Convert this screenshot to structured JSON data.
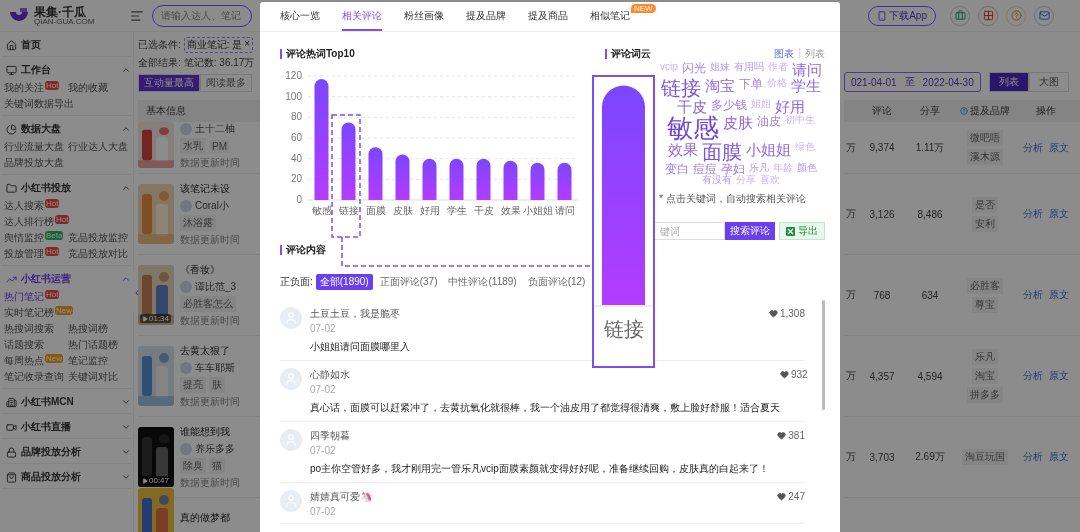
{
  "header": {
    "logo": "果集·千瓜",
    "logo_sub": "QIAN-GUA.COM",
    "search": {
      "placeholder": "请输入达人、笔记"
    },
    "download_button": "下载App"
  },
  "sidebar": {
    "collapse_handle": "«",
    "sections": [
      {
        "title": "首页",
        "kind": "link",
        "active": false
      },
      {
        "title": "工作台",
        "kind": "group",
        "active": false,
        "expanded": true,
        "items": [
          {
            "label": "我的关注",
            "selected": false,
            "badge": {
              "text": "Hot",
              "kind": "hot"
            }
          },
          {
            "label": "我的收藏",
            "selected": false
          },
          {
            "label": "关键词数据导出",
            "selected": false
          }
        ]
      },
      {
        "title": "数据大盘",
        "kind": "group",
        "active": false,
        "expanded": true,
        "items": [
          {
            "label": "行业流量大盘",
            "selected": false
          },
          {
            "label": "行业达人大盘",
            "selected": false
          },
          {
            "label": "品牌投放大盘",
            "selected": false
          }
        ]
      },
      {
        "title": "小红书投放",
        "kind": "group",
        "active": false,
        "expanded": true,
        "items": [
          {
            "label": "达人搜索",
            "selected": false,
            "badge": {
              "text": "Hot",
              "kind": "hot"
            }
          },
          {
            "label": "达人排行榜",
            "selected": false,
            "badge": {
              "text": "Hot",
              "kind": "hot"
            }
          },
          {
            "label": "舆情监控",
            "selected": false,
            "badge": {
              "text": "Beta",
              "kind": "beta"
            }
          },
          {
            "label": "竞品投放监控",
            "selected": false
          },
          {
            "label": "投放管理",
            "selected": false,
            "badge": {
              "text": "Hot",
              "kind": "hot"
            }
          },
          {
            "label": "竞品投放对比",
            "selected": false
          }
        ]
      },
      {
        "title": "小红书运营",
        "kind": "group",
        "active": true,
        "expanded": true,
        "items": [
          {
            "label": "热门笔记",
            "selected": true,
            "badge": {
              "text": "Hot",
              "kind": "hot"
            }
          },
          {
            "label": "实时笔记榜",
            "selected": false,
            "badge": {
              "text": "New",
              "kind": "new"
            }
          },
          {
            "label": "热搜词搜索",
            "selected": false
          },
          {
            "label": "热搜词榜",
            "selected": false
          },
          {
            "label": "话题搜索",
            "selected": false
          },
          {
            "label": "热门话题榜",
            "selected": false
          },
          {
            "label": "每周热点",
            "selected": false,
            "badge": {
              "text": "New",
              "kind": "new"
            }
          },
          {
            "label": "笔记监控",
            "selected": false
          },
          {
            "label": "笔记收录查询",
            "selected": false
          },
          {
            "label": "关键词对比",
            "selected": false
          }
        ]
      },
      {
        "title": "小红书MCN",
        "kind": "group",
        "active": false,
        "expanded": false
      },
      {
        "title": "小红书直播",
        "kind": "group",
        "active": false,
        "expanded": false
      },
      {
        "title": "品牌投放分析",
        "kind": "group",
        "active": false,
        "expanded": false
      },
      {
        "title": "商品投放分析",
        "kind": "group",
        "active": false,
        "expanded": false
      }
    ]
  },
  "notes": {
    "filter_label": "已选条件:",
    "filter_chip": "商业笔记: 是",
    "chip_close": "×",
    "result_label": "全部结果:",
    "result_count": "笔记数: 36.17万",
    "sort_tabs": [
      {
        "label": "互动量最高",
        "selected": true
      },
      {
        "label": "阅读最多",
        "selected": false
      }
    ],
    "date_from": "021-04-01",
    "date_sep": "至",
    "date_to": "2022-04-30",
    "view_toggle": [
      {
        "label": "列表",
        "selected": true
      },
      {
        "label": "大图",
        "selected": false
      }
    ],
    "columns": [
      "基本信息",
      "评论",
      "分享",
      "提及品牌",
      "操作"
    ],
    "rows": [
      {
        "author": "土十二柚",
        "tags": [
          "水乳",
          "PM"
        ],
        "update": "数据更新时间",
        "col_cut": "万",
        "comments": "9,374",
        "shares": "1.11万",
        "brands": [
          "微吧唔",
          "溪木源"
        ],
        "actions": [
          "分析",
          "原文"
        ]
      },
      {
        "title": "该笔记未设",
        "author": "Coral小",
        "tags": [
          "沐浴露"
        ],
        "update": "数据更新时间",
        "col_cut": "万",
        "comments": "3,126",
        "shares": "8,486",
        "brands": [
          "是否",
          "安利"
        ],
        "actions": [
          "分析",
          "原文"
        ]
      },
      {
        "title": "《香妆》",
        "author": "谭比范_3",
        "tags": [
          "必胜客怎么"
        ],
        "update": "数据更新时间",
        "duration": "01:34",
        "col_cut": "万",
        "comments": "768",
        "shares": "634",
        "brands": [
          "必胜客",
          "尊宝"
        ],
        "actions": [
          "分析",
          "原文"
        ]
      },
      {
        "title": "去黄太狠了",
        "author": "车车耶斯",
        "tags": [
          "提亮",
          "肤"
        ],
        "update": "数据更新时间",
        "col_cut": "万",
        "comments": "4,357",
        "shares": "4,594",
        "brands": [
          "乐凡",
          "淘宝",
          "拼多多"
        ],
        "actions": [
          "分析",
          "原文"
        ]
      },
      {
        "title": "谁能想到我",
        "author": "养乐多多",
        "tags": [
          "除臭",
          "猫"
        ],
        "update": "数据更新时间",
        "duration": "00:47",
        "col_cut": "万",
        "comments": "3,703",
        "shares": "2.69万",
        "brands": [
          "淘豆玩国"
        ],
        "actions": [
          "分析",
          "原文"
        ]
      },
      {
        "title": "真的做梦都"
      }
    ]
  },
  "modal": {
    "tabs": [
      {
        "label": "核心一览",
        "selected": false
      },
      {
        "label": "相关评论",
        "selected": true
      },
      {
        "label": "粉丝画像",
        "selected": false
      },
      {
        "label": "提及品牌",
        "selected": false
      },
      {
        "label": "提及商品",
        "selected": false
      },
      {
        "label": "相似笔记",
        "selected": false,
        "badge": "NEW"
      }
    ],
    "hot_words": {
      "chart_data": {
        "type": "bar",
        "title": "评论热词Top10",
        "categories": [
          "敏感",
          "链接",
          "面膜",
          "皮肤",
          "好用",
          "学生",
          "干皮",
          "效果",
          "小姐姐",
          "请问"
        ],
        "values": [
          117,
          75,
          51,
          44,
          40,
          40,
          40,
          38,
          36,
          36
        ],
        "ylim": [
          0,
          120
        ],
        "yticks": [
          0,
          20,
          40,
          60,
          80,
          100,
          120
        ],
        "grid": true
      }
    },
    "word_cloud": {
      "title": "评论词云",
      "views": [
        {
          "label": "图表",
          "selected": true
        },
        {
          "label": "列表",
          "selected": false
        }
      ],
      "separator": "|",
      "words": [
        {
          "text": "vcip",
          "kind": "tiny"
        },
        {
          "text": "闪光",
          "kind": "medium"
        },
        {
          "text": "姐妹",
          "kind": "small"
        },
        {
          "text": "有用吗",
          "kind": "small"
        },
        {
          "text": "作者",
          "kind": "tiny"
        },
        {
          "text": "请问",
          "kind": "large"
        },
        {
          "text": "链接",
          "kind": "huge"
        },
        {
          "text": "淘宝",
          "kind": "large"
        },
        {
          "text": "下单",
          "kind": "medium"
        },
        {
          "text": "价格",
          "kind": "tiny"
        },
        {
          "text": "学生",
          "kind": "large"
        },
        {
          "text": "干皮",
          "kind": "large"
        },
        {
          "text": "多少钱",
          "kind": "medium"
        },
        {
          "text": "姐姐",
          "kind": "tiny"
        },
        {
          "text": "好用",
          "kind": "large"
        },
        {
          "text": "敏感",
          "kind": "top"
        },
        {
          "text": "皮肤",
          "kind": "large"
        },
        {
          "text": "油皮",
          "kind": "medium"
        },
        {
          "text": "初中生",
          "kind": "tiny"
        },
        {
          "text": "效果",
          "kind": "large"
        },
        {
          "text": "面膜",
          "kind": "huge"
        },
        {
          "text": "小姐姐",
          "kind": "large"
        },
        {
          "text": "绿色",
          "kind": "tiny"
        },
        {
          "text": "变白",
          "kind": "medium"
        },
        {
          "text": "痘痘",
          "kind": "medium"
        },
        {
          "text": "孕妇",
          "kind": "medium"
        },
        {
          "text": "乐凡",
          "kind": "small"
        },
        {
          "text": "年龄",
          "kind": "tiny"
        },
        {
          "text": "颜色",
          "kind": "small"
        },
        {
          "text": "有没有",
          "kind": "small"
        },
        {
          "text": "分享",
          "kind": "tiny"
        },
        {
          "text": "喜欢",
          "kind": "tiny"
        }
      ],
      "note": "* 点击关键词，自动搜索相关评论",
      "search": {
        "placeholder": "键词"
      },
      "search_button": "搜索评论",
      "export_button": "导出"
    },
    "comments": {
      "title": "评论内容",
      "filter_label": "正负面:",
      "filters": [
        {
          "label": "全部(1890)",
          "selected": true
        },
        {
          "label": "正面评论(37)",
          "selected": false
        },
        {
          "label": "中性评论(1189)",
          "selected": false
        },
        {
          "label": "负面评论(12)",
          "selected": false
        }
      ],
      "items": [
        {
          "user": "土豆土豆，我是脆枣",
          "date": "07-02",
          "text": "小姐姐请问面膜哪里入",
          "likes": "1,308"
        },
        {
          "user": "心静如水",
          "date": "07-02",
          "text": "真心话，面膜可以赶紧冲了，去黄抗氧化就很棒，我一个油皮用了都觉得很清爽，敷上脸好舒服！适合夏天",
          "likes": "932"
        },
        {
          "user": "四季朝暮",
          "date": "07-02",
          "text": "po主你空管好多，我才刚用完一管乐凡vcip面膜素颜就变得好好呢，准备继续回购，皮肤真的白起来了！",
          "likes": "381"
        },
        {
          "user": "婧婧真可爱🦄",
          "date": "07-02",
          "likes": "247"
        }
      ]
    },
    "magnifier": {
      "label": "链接"
    }
  }
}
